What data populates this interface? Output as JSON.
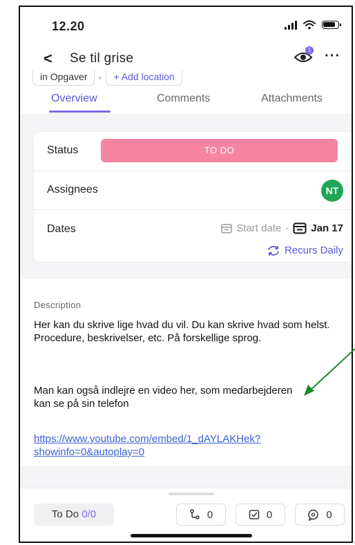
{
  "status_bar": {
    "time": "12.20"
  },
  "header": {
    "back_symbol": "<",
    "title": "Se til grise",
    "watch_count": "1",
    "more": "···"
  },
  "chips": {
    "list": "in Opgaver",
    "location": "+ Add location"
  },
  "tabs": [
    {
      "label": "Overview"
    },
    {
      "label": "Comments"
    },
    {
      "label": "Attachments"
    }
  ],
  "details": {
    "status_label": "Status",
    "status_value": "TO DO",
    "status_color": "#f585a3",
    "assignees_label": "Assignees",
    "assignee_initials": "NT",
    "assignee_color": "#21a558",
    "dates_label": "Dates",
    "start_date": "Start date",
    "date_sep": "-",
    "due_date": "Jan 17",
    "recurs": "Recurs Daily"
  },
  "description": {
    "label": "Description",
    "paragraph1": "Her kan du skrive lige hvad du vil. Du kan skrive hvad som helst. Procedure, beskrivelser, etc. På forskellige sprog.",
    "paragraph2": "Man kan også indlejre en video her, som medarbejderen kan se på sin telefon",
    "link": "https://www.youtube.com/embed/1_dAYLAKHek?showinfo=0&autoplay=0"
  },
  "bottom_bar": {
    "todo_label": "To Do",
    "todo_count": "0/0",
    "subtasks_count": "0",
    "checklist_count": "0",
    "comments_count": "0"
  },
  "colors": {
    "accent": "#7b68ee",
    "annotation_arrow": "#1a8a2a"
  }
}
